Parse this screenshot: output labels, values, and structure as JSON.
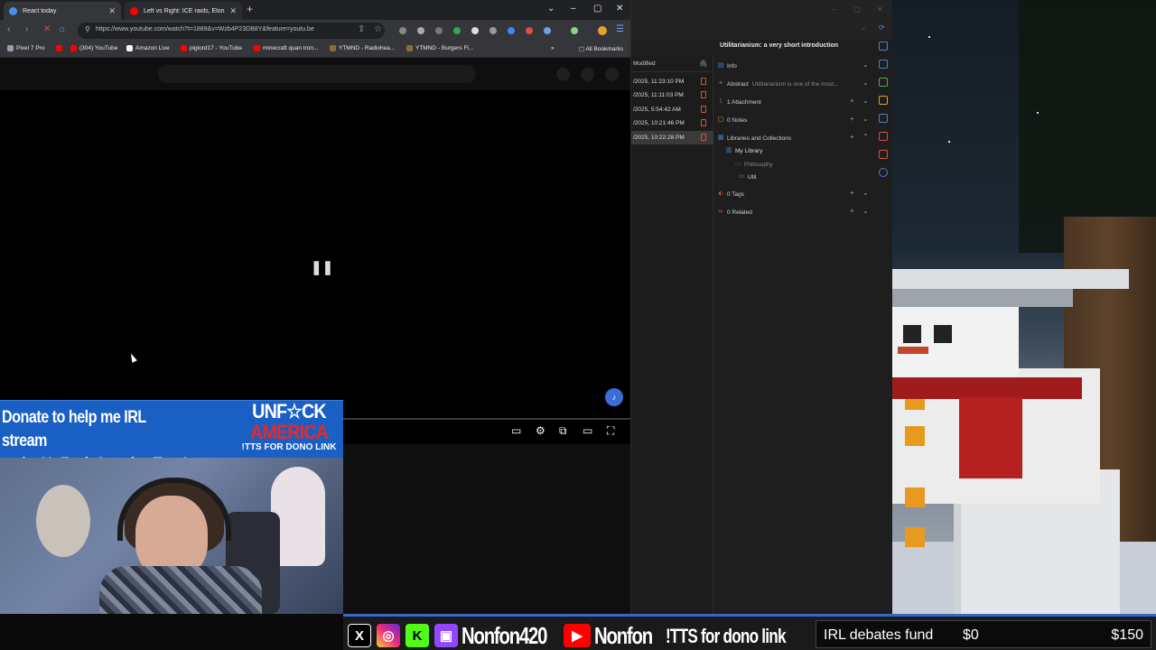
{
  "browser": {
    "tabs": [
      {
        "title": "React today",
        "active": true
      },
      {
        "title": "Left vs Right: ICE raids, Elon M",
        "active": false
      }
    ],
    "url": "https://www.youtube.com/watch?t=1889&v=Wzb4P23DB8Y&feature=youtu.be",
    "bookmarks": [
      {
        "label": "Pixel 7 Pro",
        "color": "#9aa0a6"
      },
      {
        "label": "",
        "color": "#ff0000"
      },
      {
        "label": "(304) YouTube",
        "color": "#ff0000"
      },
      {
        "label": "Amazon Live",
        "color": "#f5f5f5"
      },
      {
        "label": "piglord17 - YouTube",
        "color": "#ff0000"
      },
      {
        "label": "minecraft quan tron...",
        "color": "#ff0000"
      },
      {
        "label": "YTMND - Radiohea...",
        "color": "#8a6d3b"
      },
      {
        "label": "YTMND - Burgers Fl...",
        "color": "#8a6d3b"
      }
    ],
    "all_bookmarks": "All Bookmarks"
  },
  "zotero": {
    "item_title": "Utilitarianism: a very short introduction",
    "list_header": "Modified",
    "rows": [
      {
        "date": "/2025, 11:23:10 PM",
        "selected": false
      },
      {
        "date": "/2025, 11:11:03 PM",
        "selected": false
      },
      {
        "date": "/2025, 5:54:42 AM",
        "selected": false
      },
      {
        "date": "/2025, 10:21:46 PM",
        "selected": false
      },
      {
        "date": "/2025, 10:22:28 PM",
        "selected": true
      }
    ],
    "sections": {
      "info": "Info",
      "abstract_label": "Abstract",
      "abstract_text": "Utilitarianism is one of the most...",
      "attachment": "1 Attachment",
      "notes": "0 Notes",
      "libraries": "Libraries and Collections",
      "my_library": "My Library",
      "philosophy": "Philosophy",
      "util": "Util",
      "tags": "0 Tags",
      "related": "0 Related"
    }
  },
  "overlay": {
    "donate_line1": "Donate to help me  IRL stream",
    "donate_line2": "at the UnFuck America Tour!",
    "unfuck_l1": "UNF☆CK",
    "unfuck_l2": "AMERICA",
    "unfuck_l3": "!TTS FOR DONO LINK"
  },
  "bottom_bar": {
    "handle1": "Nonfon420",
    "handle2": "Nonfon",
    "tts": "!TTS for dono link",
    "fund_label": "IRL debates fund",
    "fund_current": "$0",
    "fund_goal": "$150",
    "fund_progress": 0
  },
  "colors": {
    "accent": "#3468c9",
    "youtube_red": "#ff0000",
    "zotero_pdf": "#d5543b"
  }
}
